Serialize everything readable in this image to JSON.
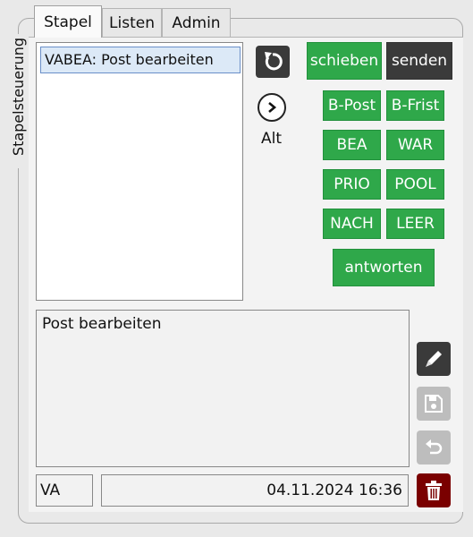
{
  "group": {
    "label": "Stapelsteuerung"
  },
  "tabs": [
    {
      "label": "Stapel",
      "active": true
    },
    {
      "label": "Listen",
      "active": false
    },
    {
      "label": "Admin",
      "active": false
    }
  ],
  "list": {
    "items": [
      "VABEA: Post bearbeiten"
    ],
    "selected_index": 0
  },
  "nav": {
    "refresh_icon": "refresh-icon",
    "next_icon": "chevron-right-icon",
    "alt_label": "Alt"
  },
  "actions": {
    "schieben": "schieben",
    "senden": "senden",
    "b_post": "B-Post",
    "b_frist": "B-Frist",
    "bea": "BEA",
    "war": "WAR",
    "prio": "PRIO",
    "pool": "POOL",
    "nach": "NACH",
    "leer": "LEER",
    "antworten": "antworten"
  },
  "detail": {
    "text": "Post bearbeiten"
  },
  "footer": {
    "user": "VA",
    "timestamp": "04.11.2024 16:36"
  },
  "side_buttons": {
    "edit_icon": "pen-icon",
    "save_icon": "save-icon",
    "undo_icon": "undo-icon",
    "delete_icon": "trash-icon"
  },
  "colors": {
    "green": "#2fa84a",
    "dark": "#3a3a3a",
    "selected": "#dce9f7",
    "delete": "#7a0000",
    "disabled": "#b9b9b9"
  }
}
